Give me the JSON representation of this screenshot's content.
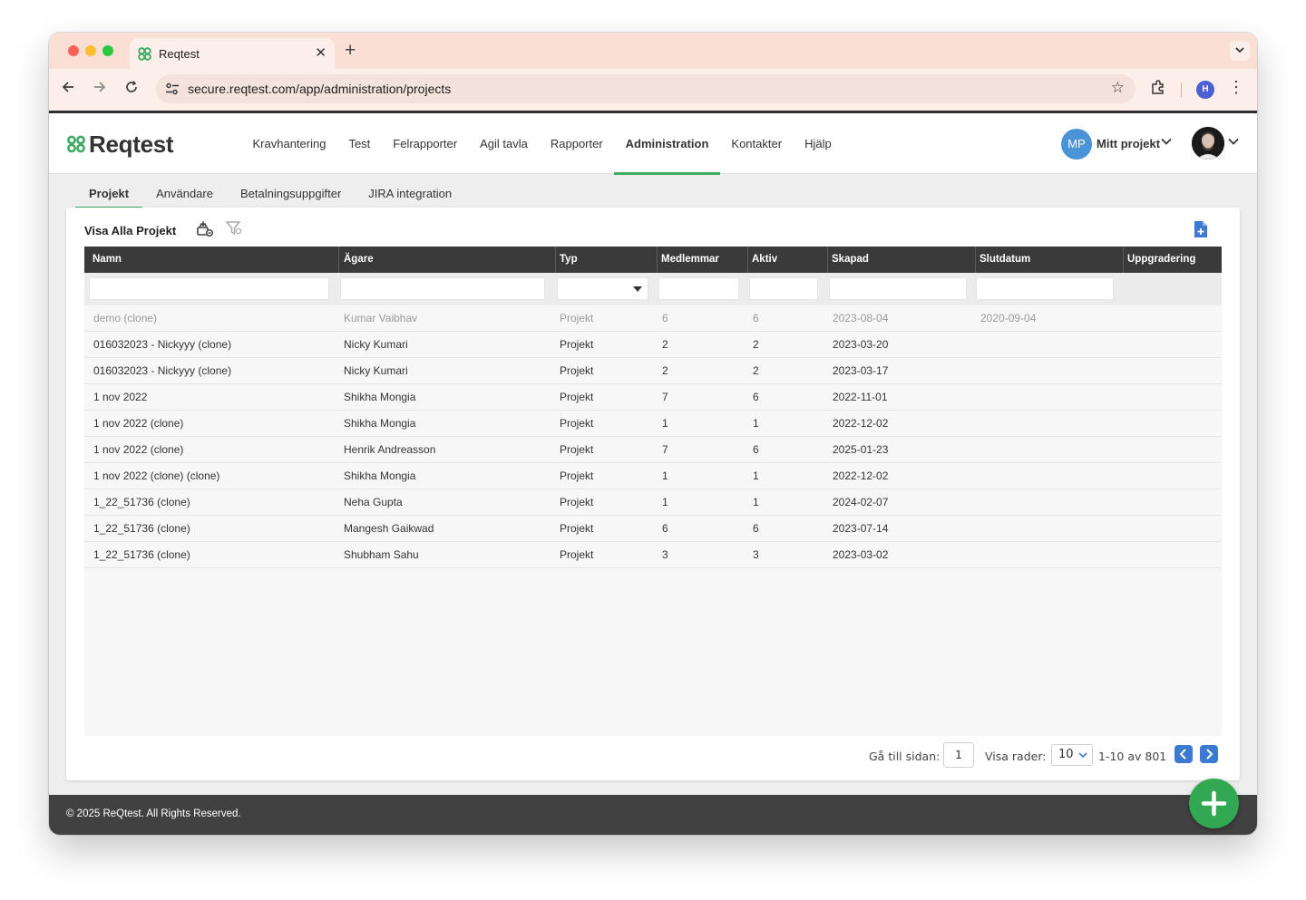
{
  "browser": {
    "tab_title": "Reqtest",
    "tab_close": "✕",
    "new_tab": "+",
    "url": "secure.reqtest.com/app/administration/projects",
    "profile_initial": "H"
  },
  "app": {
    "logo_text": "Reqtest",
    "nav": [
      {
        "label": "Kravhantering",
        "active": false
      },
      {
        "label": "Test",
        "active": false
      },
      {
        "label": "Felrapporter",
        "active": false
      },
      {
        "label": "Agil tavla",
        "active": false
      },
      {
        "label": "Rapporter",
        "active": false
      },
      {
        "label": "Administration",
        "active": true
      },
      {
        "label": "Kontakter",
        "active": false
      },
      {
        "label": "Hjälp",
        "active": false
      }
    ],
    "project_initials": "MP",
    "project_name": "Mitt projekt",
    "subnav": [
      {
        "label": "Projekt",
        "active": true
      },
      {
        "label": "Användare",
        "active": false
      },
      {
        "label": "Betalningsuppgifter",
        "active": false
      },
      {
        "label": "JIRA integration",
        "active": false
      }
    ],
    "accent_color": "#3eaa63",
    "primary_color": "#3a7ad0"
  },
  "panel": {
    "title": "Visa Alla Projekt",
    "columns": [
      "Namn",
      "Ägare",
      "Typ",
      "Medlemmar",
      "Aktiv",
      "Skapad",
      "Slutdatum",
      "Uppgradering"
    ],
    "rows": [
      {
        "name": "demo (clone)",
        "owner": "Kumar Vaibhav",
        "type": "Projekt",
        "members": "6",
        "active": "6",
        "created": "2023-08-04",
        "end": "2020-09-04",
        "upgrade": "",
        "dimmed": true
      },
      {
        "name": "016032023 - Nickyyy (clone)",
        "owner": "Nicky Kumari",
        "type": "Projekt",
        "members": "2",
        "active": "2",
        "created": "2023-03-20",
        "end": "",
        "upgrade": ""
      },
      {
        "name": "016032023 - Nickyyy (clone)",
        "owner": "Nicky Kumari",
        "type": "Projekt",
        "members": "2",
        "active": "2",
        "created": "2023-03-17",
        "end": "",
        "upgrade": ""
      },
      {
        "name": "1 nov 2022",
        "owner": "Shikha Mongia",
        "type": "Projekt",
        "members": "7",
        "active": "6",
        "created": "2022-11-01",
        "end": "",
        "upgrade": ""
      },
      {
        "name": "1 nov 2022 (clone)",
        "owner": "Shikha Mongia",
        "type": "Projekt",
        "members": "1",
        "active": "1",
        "created": "2022-12-02",
        "end": "",
        "upgrade": ""
      },
      {
        "name": "1 nov 2022 (clone)",
        "owner": "Henrik Andreasson",
        "type": "Projekt",
        "members": "7",
        "active": "6",
        "created": "2025-01-23",
        "end": "",
        "upgrade": ""
      },
      {
        "name": "1 nov 2022 (clone) (clone)",
        "owner": "Shikha Mongia",
        "type": "Projekt",
        "members": "1",
        "active": "1",
        "created": "2022-12-02",
        "end": "",
        "upgrade": ""
      },
      {
        "name": "1_22_51736 (clone)",
        "owner": "Neha Gupta",
        "type": "Projekt",
        "members": "1",
        "active": "1",
        "created": "2024-02-07",
        "end": "",
        "upgrade": ""
      },
      {
        "name": "1_22_51736 (clone)",
        "owner": "Mangesh Gaikwad",
        "type": "Projekt",
        "members": "6",
        "active": "6",
        "created": "2023-07-14",
        "end": "",
        "upgrade": ""
      },
      {
        "name": "1_22_51736 (clone)",
        "owner": "Shubham Sahu",
        "type": "Projekt",
        "members": "3",
        "active": "3",
        "created": "2023-03-02",
        "end": "",
        "upgrade": ""
      }
    ]
  },
  "pagination": {
    "goto_label": "Gå till sidan:",
    "goto_value": "1",
    "rows_label": "Visa rader:",
    "rows_value": "10",
    "range_text": "1-10 av 801"
  },
  "footer": {
    "copyright": "© 2025 ReQtest. All Rights Reserved."
  },
  "icons": {
    "fab": "plus-icon",
    "export": "export-projects-icon",
    "filter": "filter-clear-icon",
    "add_file": "add-file-icon"
  }
}
